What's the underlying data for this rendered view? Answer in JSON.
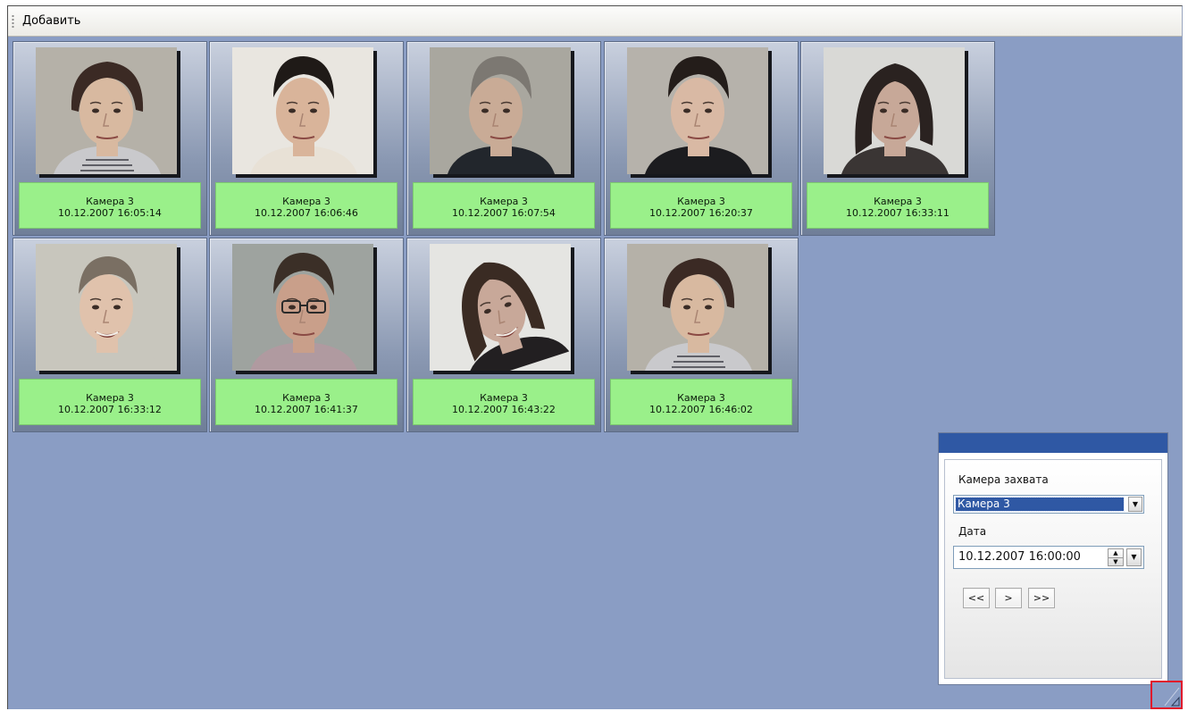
{
  "toolbar": {
    "add_label": "Добавить"
  },
  "captures": [
    {
      "camera": "Камера 3",
      "time": "10.12.2007 16:05:14",
      "photo": "face-woman-short-hair"
    },
    {
      "camera": "Камера 3",
      "time": "10.12.2007 16:06:46",
      "photo": "face-man-dark-hair"
    },
    {
      "camera": "Камера 3",
      "time": "10.12.2007 16:07:54",
      "photo": "face-man-profile"
    },
    {
      "camera": "Камера 3",
      "time": "10.12.2007 16:20:37",
      "photo": "face-young-man"
    },
    {
      "camera": "Камера 3",
      "time": "10.12.2007 16:33:11",
      "photo": "face-woman-long-hair"
    },
    {
      "camera": "Камера 3",
      "time": "10.12.2007 16:33:12",
      "photo": "face-man-smiling"
    },
    {
      "camera": "Камера 3",
      "time": "10.12.2007 16:41:37",
      "photo": "face-man-glasses"
    },
    {
      "camera": "Камера 3",
      "time": "10.12.2007 16:43:22",
      "photo": "face-woman-tilted"
    },
    {
      "camera": "Камера 3",
      "time": "10.12.2007 16:46:02",
      "photo": "face-woman-short-hair"
    }
  ],
  "filter_panel": {
    "title": "",
    "camera_label": "Камера захвата",
    "camera_value": "Камера 3",
    "date_label": "Дата",
    "date_value": "10.12.2007 16:00:00",
    "first_label": "<<",
    "next_label": ">",
    "last_label": ">>"
  },
  "colors": {
    "background": "#8a9dc4",
    "caption_bg": "#9af08a",
    "panel_title": "#2f58a4",
    "highlight_border": "#e0192b"
  }
}
